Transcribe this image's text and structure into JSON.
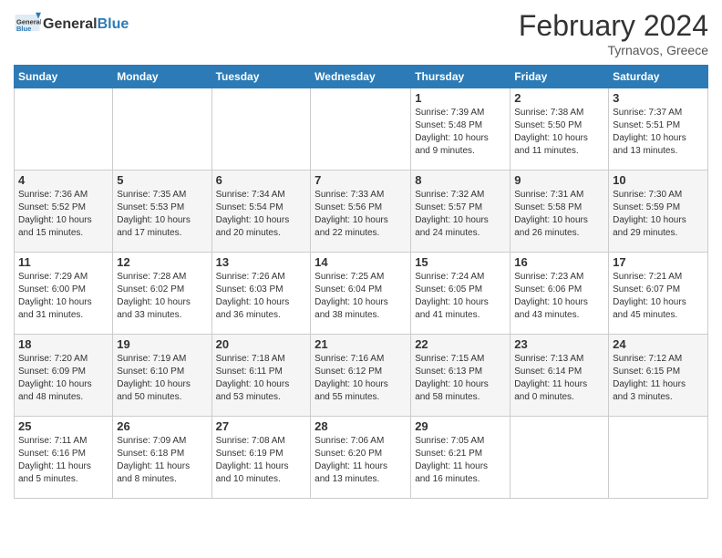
{
  "header": {
    "logo": {
      "general": "General",
      "blue": "Blue"
    },
    "title": "February 2024",
    "location": "Tyrnavos, Greece"
  },
  "weekdays": [
    "Sunday",
    "Monday",
    "Tuesday",
    "Wednesday",
    "Thursday",
    "Friday",
    "Saturday"
  ],
  "weeks": [
    [
      {
        "day": "",
        "info": ""
      },
      {
        "day": "",
        "info": ""
      },
      {
        "day": "",
        "info": ""
      },
      {
        "day": "",
        "info": ""
      },
      {
        "day": "1",
        "info": "Sunrise: 7:39 AM\nSunset: 5:48 PM\nDaylight: 10 hours\nand 9 minutes."
      },
      {
        "day": "2",
        "info": "Sunrise: 7:38 AM\nSunset: 5:50 PM\nDaylight: 10 hours\nand 11 minutes."
      },
      {
        "day": "3",
        "info": "Sunrise: 7:37 AM\nSunset: 5:51 PM\nDaylight: 10 hours\nand 13 minutes."
      }
    ],
    [
      {
        "day": "4",
        "info": "Sunrise: 7:36 AM\nSunset: 5:52 PM\nDaylight: 10 hours\nand 15 minutes."
      },
      {
        "day": "5",
        "info": "Sunrise: 7:35 AM\nSunset: 5:53 PM\nDaylight: 10 hours\nand 17 minutes."
      },
      {
        "day": "6",
        "info": "Sunrise: 7:34 AM\nSunset: 5:54 PM\nDaylight: 10 hours\nand 20 minutes."
      },
      {
        "day": "7",
        "info": "Sunrise: 7:33 AM\nSunset: 5:56 PM\nDaylight: 10 hours\nand 22 minutes."
      },
      {
        "day": "8",
        "info": "Sunrise: 7:32 AM\nSunset: 5:57 PM\nDaylight: 10 hours\nand 24 minutes."
      },
      {
        "day": "9",
        "info": "Sunrise: 7:31 AM\nSunset: 5:58 PM\nDaylight: 10 hours\nand 26 minutes."
      },
      {
        "day": "10",
        "info": "Sunrise: 7:30 AM\nSunset: 5:59 PM\nDaylight: 10 hours\nand 29 minutes."
      }
    ],
    [
      {
        "day": "11",
        "info": "Sunrise: 7:29 AM\nSunset: 6:00 PM\nDaylight: 10 hours\nand 31 minutes."
      },
      {
        "day": "12",
        "info": "Sunrise: 7:28 AM\nSunset: 6:02 PM\nDaylight: 10 hours\nand 33 minutes."
      },
      {
        "day": "13",
        "info": "Sunrise: 7:26 AM\nSunset: 6:03 PM\nDaylight: 10 hours\nand 36 minutes."
      },
      {
        "day": "14",
        "info": "Sunrise: 7:25 AM\nSunset: 6:04 PM\nDaylight: 10 hours\nand 38 minutes."
      },
      {
        "day": "15",
        "info": "Sunrise: 7:24 AM\nSunset: 6:05 PM\nDaylight: 10 hours\nand 41 minutes."
      },
      {
        "day": "16",
        "info": "Sunrise: 7:23 AM\nSunset: 6:06 PM\nDaylight: 10 hours\nand 43 minutes."
      },
      {
        "day": "17",
        "info": "Sunrise: 7:21 AM\nSunset: 6:07 PM\nDaylight: 10 hours\nand 45 minutes."
      }
    ],
    [
      {
        "day": "18",
        "info": "Sunrise: 7:20 AM\nSunset: 6:09 PM\nDaylight: 10 hours\nand 48 minutes."
      },
      {
        "day": "19",
        "info": "Sunrise: 7:19 AM\nSunset: 6:10 PM\nDaylight: 10 hours\nand 50 minutes."
      },
      {
        "day": "20",
        "info": "Sunrise: 7:18 AM\nSunset: 6:11 PM\nDaylight: 10 hours\nand 53 minutes."
      },
      {
        "day": "21",
        "info": "Sunrise: 7:16 AM\nSunset: 6:12 PM\nDaylight: 10 hours\nand 55 minutes."
      },
      {
        "day": "22",
        "info": "Sunrise: 7:15 AM\nSunset: 6:13 PM\nDaylight: 10 hours\nand 58 minutes."
      },
      {
        "day": "23",
        "info": "Sunrise: 7:13 AM\nSunset: 6:14 PM\nDaylight: 11 hours\nand 0 minutes."
      },
      {
        "day": "24",
        "info": "Sunrise: 7:12 AM\nSunset: 6:15 PM\nDaylight: 11 hours\nand 3 minutes."
      }
    ],
    [
      {
        "day": "25",
        "info": "Sunrise: 7:11 AM\nSunset: 6:16 PM\nDaylight: 11 hours\nand 5 minutes."
      },
      {
        "day": "26",
        "info": "Sunrise: 7:09 AM\nSunset: 6:18 PM\nDaylight: 11 hours\nand 8 minutes."
      },
      {
        "day": "27",
        "info": "Sunrise: 7:08 AM\nSunset: 6:19 PM\nDaylight: 11 hours\nand 10 minutes."
      },
      {
        "day": "28",
        "info": "Sunrise: 7:06 AM\nSunset: 6:20 PM\nDaylight: 11 hours\nand 13 minutes."
      },
      {
        "day": "29",
        "info": "Sunrise: 7:05 AM\nSunset: 6:21 PM\nDaylight: 11 hours\nand 16 minutes."
      },
      {
        "day": "",
        "info": ""
      },
      {
        "day": "",
        "info": ""
      }
    ]
  ]
}
